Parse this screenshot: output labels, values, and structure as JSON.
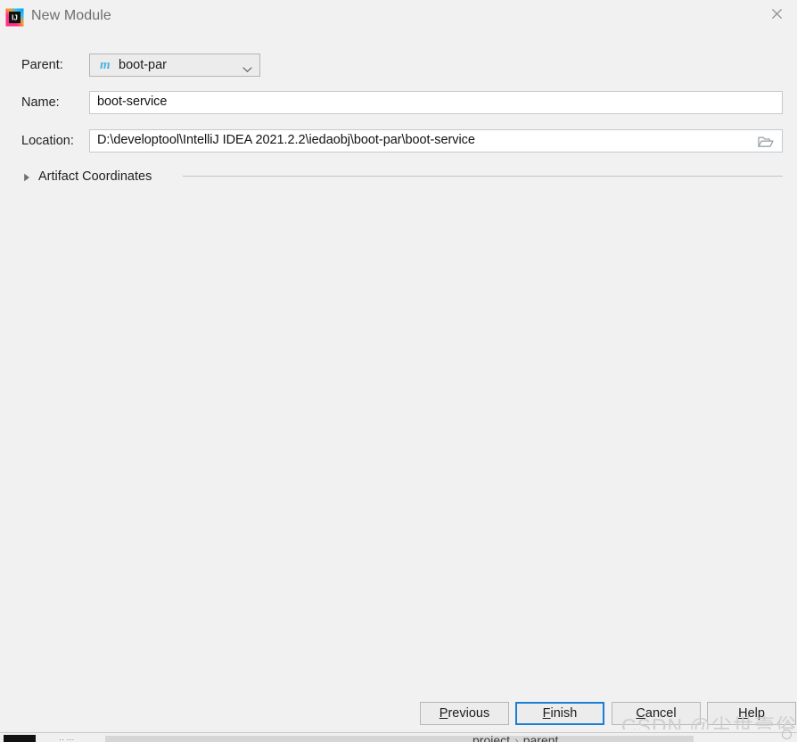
{
  "window": {
    "title": "New Module",
    "app_icon": "intellij-idea-logo",
    "close_icon": "close-icon"
  },
  "form": {
    "parent": {
      "label": "Parent:",
      "value": "boot-par",
      "icon": "maven-module-icon",
      "icon_glyph": "m",
      "arrow_icon": "chevron-down-icon"
    },
    "name": {
      "label": "Name:",
      "value": "boot-service",
      "placeholder": ""
    },
    "location": {
      "label": "Location:",
      "value": "D:\\developtool\\IntelliJ IDEA 2021.2.2\\iedaobj\\boot-par\\boot-service",
      "placeholder": "",
      "browse_icon": "folder-open-icon"
    }
  },
  "section": {
    "title": "Artifact Coordinates",
    "expanded": false,
    "disclosure_icon": "triangle-right-icon"
  },
  "buttons": {
    "previous": {
      "prefix": "",
      "mnemonic": "P",
      "suffix": "revious"
    },
    "finish": {
      "prefix": "",
      "mnemonic": "F",
      "suffix": "inish",
      "focused": true
    },
    "cancel": {
      "prefix": "",
      "mnemonic": "C",
      "suffix": "ancel"
    },
    "help": {
      "prefix": "",
      "mnemonic": "H",
      "suffix": "elp"
    }
  },
  "watermark": {
    "text": "CSDN @尘世壹俗人"
  },
  "backdrop": {
    "breadcrumb_first": "project",
    "breadcrumb_sep": "›",
    "breadcrumb_second": "parent",
    "dots": "··  ···"
  },
  "colors": {
    "dialog_background": "#f1f1f1",
    "focus_blue": "#1a7fd4",
    "maven_icon_blue": "#4ab3e0",
    "field_border": "#c3c9cf",
    "text": "#1f1f1f",
    "title_text": "#6e6e6e",
    "watermark": "#cfcfcf"
  }
}
